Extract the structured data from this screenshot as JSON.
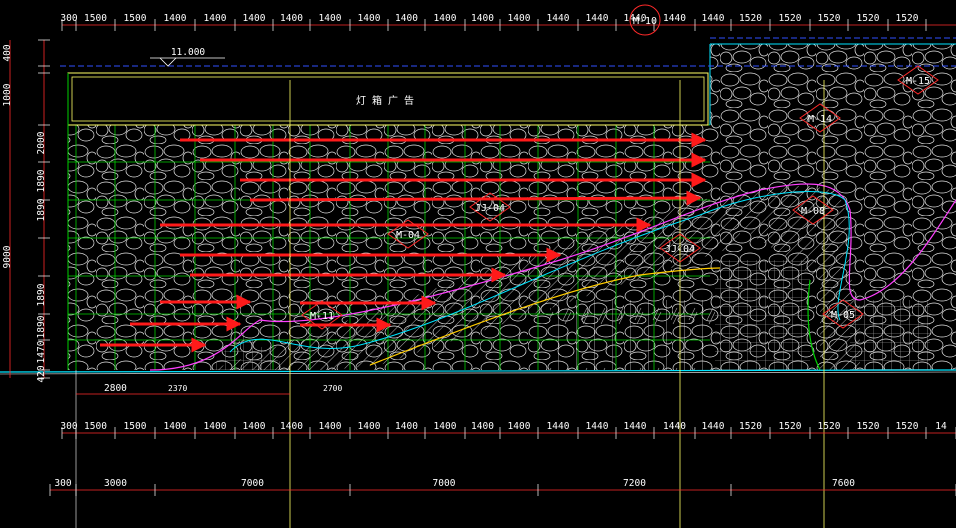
{
  "colors": {
    "background": "#000000",
    "dimension_line": "#ff2a2a",
    "grid_green": "#00d000",
    "outline_cyan": "#00e5ff",
    "outline_magenta": "#ff40ff",
    "arrow_red": "#ff1a1a",
    "stone": "#e8e8e8",
    "text": "#ffffff",
    "axis_yellow": "#ffff66",
    "hatch": "#dddddd"
  },
  "top_dims": [
    "300",
    "1500",
    "1500",
    "1400",
    "1400",
    "1400",
    "1400",
    "1400",
    "1400",
    "1400",
    "1400",
    "1400",
    "1400",
    "1440",
    "1440",
    "1440",
    "1440",
    "1440",
    "1520",
    "1520",
    "1520",
    "1520",
    "1520"
  ],
  "bottom_dims": [
    "300",
    "1500",
    "1500",
    "1400",
    "1400",
    "1400",
    "1400",
    "1400",
    "1400",
    "1400",
    "1400",
    "1400",
    "1400",
    "1440",
    "1440",
    "1440",
    "1440",
    "1440",
    "1520",
    "1520",
    "1520",
    "1520",
    "1520",
    "14"
  ],
  "overall_dims": [
    "300",
    "3000",
    "7000",
    "7000",
    "7200",
    "7600"
  ],
  "left_dims": [
    "400",
    "1000",
    "2000",
    "1890",
    "1890",
    "9000",
    "1890",
    "1890",
    "1470",
    "420"
  ],
  "elevation_mark": "11.000",
  "banner_text": "灯 箱 广 告",
  "ground_dims": [
    "2800",
    "2370",
    "2700"
  ],
  "tags": [
    "M-10",
    "M-15",
    "M-14",
    "M-08",
    "JJ-04",
    "M-04",
    "JJ-04",
    "M-11",
    "M-05"
  ]
}
